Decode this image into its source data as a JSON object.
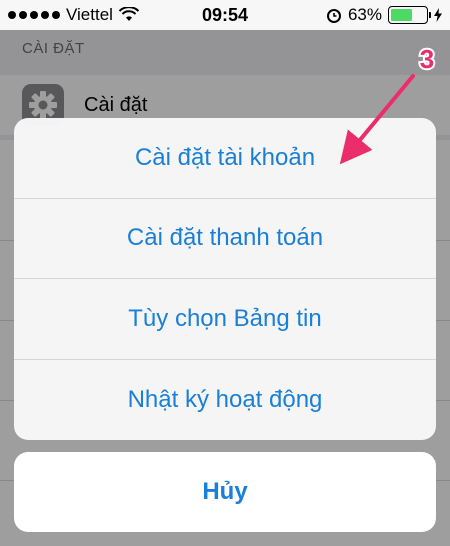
{
  "status_bar": {
    "carrier": "Viettel",
    "time": "09:54",
    "battery_percent": "63%",
    "battery_level": 0.63,
    "icons": [
      "signal-dots-icon",
      "wifi-icon",
      "alarm-icon",
      "battery-icon",
      "charging-bolt-icon"
    ]
  },
  "page": {
    "section_header": "CÀI ĐẶT",
    "settings_row_label": "Cài đặt",
    "settings_row_icon": "gear-icon"
  },
  "action_sheet": {
    "items": [
      {
        "label": "Cài đặt tài khoản"
      },
      {
        "label": "Cài đặt thanh toán"
      },
      {
        "label": "Tùy chọn Bảng tin"
      },
      {
        "label": "Nhật ký hoạt động"
      }
    ],
    "cancel_label": "Hủy"
  },
  "annotation": {
    "step_number": "3",
    "color": "#ec2d6b"
  },
  "colors": {
    "accent": "#1a7fd6",
    "battery": "#4cd964"
  }
}
